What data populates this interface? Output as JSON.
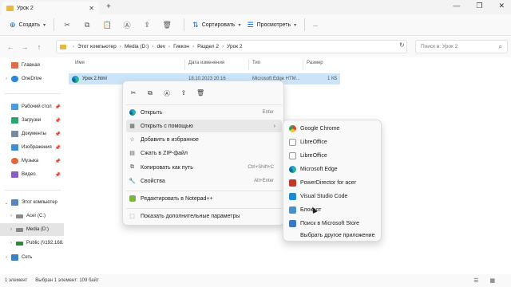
{
  "window": {
    "tab_title": "Урок 2",
    "new_tab": "+",
    "minimize": "—",
    "maximize": "❐",
    "close": "✕"
  },
  "toolbar": {
    "create_label": "Создать",
    "sort_label": "Сортировать",
    "view_label": "Просмотреть",
    "more_label": "..."
  },
  "address": {
    "crumbs": [
      "Этот компьютер",
      "Media (D:)",
      "dev",
      "Гиккон",
      "Раздел 2",
      "Урок 2"
    ],
    "search_placeholder": "Поиск в: Урок 2"
  },
  "sidebar": {
    "items": [
      {
        "label": "Главная",
        "color": "#e06b4a"
      },
      {
        "label": "OneDrive",
        "color": "#2b88d8"
      },
      {
        "label": "Рабочий стол",
        "color": "#4a9be0"
      },
      {
        "label": "Загрузки",
        "color": "#2ea36e"
      },
      {
        "label": "Документы",
        "color": "#7a8ba0"
      },
      {
        "label": "Изображения",
        "color": "#3f8fd2"
      },
      {
        "label": "Музыка",
        "color": "#e0663a"
      },
      {
        "label": "Видео",
        "color": "#8a5cc6"
      },
      {
        "label": "Этот компьютер",
        "color": "#5a86b5"
      },
      {
        "label": "Acer (C:)",
        "color": "#888888"
      },
      {
        "label": "Media (D:)",
        "color": "#888888"
      },
      {
        "label": "Public (\\\\192.168.",
        "color": "#2a8a3a"
      },
      {
        "label": "Сеть",
        "color": "#3f7fc4"
      }
    ]
  },
  "filelist": {
    "columns": [
      "Имя",
      "Дата изменения",
      "Тип",
      "Размер"
    ],
    "rows": [
      {
        "name": "Урок 2.html",
        "date": "18.10.2023 20:16",
        "type": "Microsoft Edge HTM...",
        "size": "1 КБ"
      }
    ]
  },
  "context_menu": {
    "items": [
      {
        "label": "Открыть",
        "shortcut": "Enter"
      },
      {
        "label": "Открыть с помощью",
        "shortcut": ""
      },
      {
        "label": "Добавить в избранное",
        "shortcut": ""
      },
      {
        "label": "Сжать в ZIP-файл",
        "shortcut": ""
      },
      {
        "label": "Копировать как путь",
        "shortcut": "Ctrl+Shift+C"
      },
      {
        "label": "Свойства",
        "shortcut": "Alt+Enter"
      },
      {
        "label": "Редактировать в Notepad++",
        "shortcut": ""
      },
      {
        "label": "Показать дополнительные параметры",
        "shortcut": ""
      }
    ]
  },
  "submenu": {
    "items": [
      {
        "label": "Google Chrome",
        "color": "#e34133"
      },
      {
        "label": "LibreOffice",
        "color": "#ffffff"
      },
      {
        "label": "LibreOffice",
        "color": "#ffffff"
      },
      {
        "label": "Microsoft Edge",
        "color": "#1fa2e0"
      },
      {
        "label": "PowerDirector for acer",
        "color": "#c0392b"
      },
      {
        "label": "Visual Studio Code",
        "color": "#1f8ad2"
      },
      {
        "label": "Блокнот",
        "color": "#4a90c8"
      },
      {
        "label": "Поиск в Microsoft Store",
        "color": "#3b78c4"
      },
      {
        "label": "Выбрать другое приложение",
        "color": ""
      }
    ]
  },
  "status": {
    "count": "1 элемент",
    "selected": "Выбран 1 элемент: 109 байт"
  }
}
